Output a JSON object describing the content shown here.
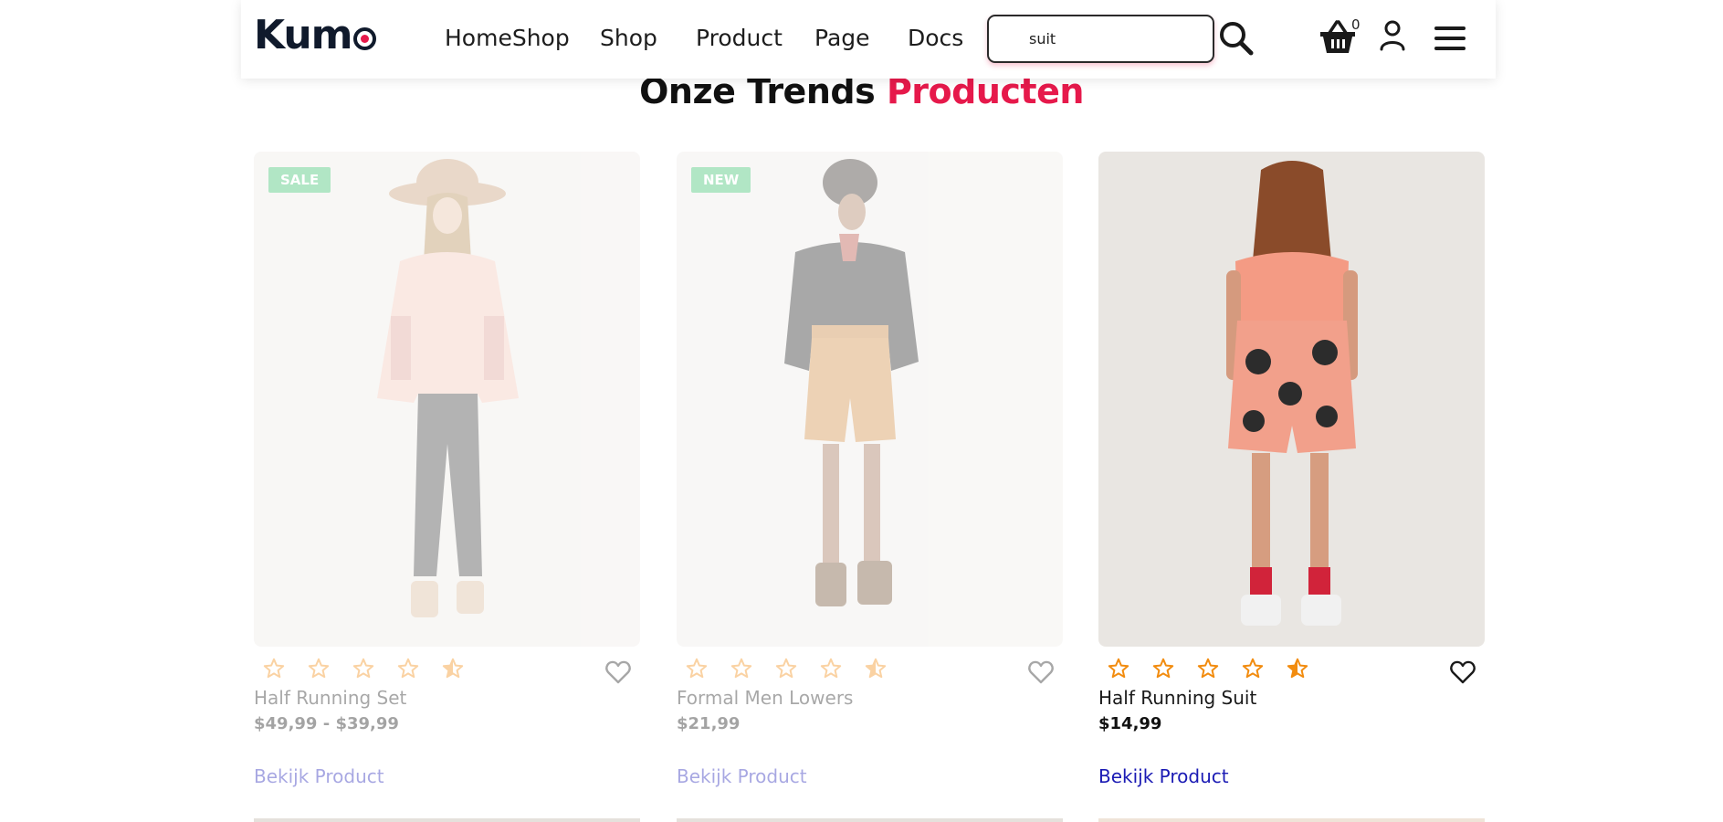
{
  "header": {
    "logo_text": "Kum",
    "nav": [
      "HomeShop",
      "Shop",
      "Product",
      "Page",
      "Docs"
    ],
    "search": {
      "value": "suit",
      "placeholder": ""
    },
    "cart_count": "0",
    "icons": [
      "search-icon",
      "basket-icon",
      "user-icon",
      "hamburger-menu-icon"
    ]
  },
  "section": {
    "title_main": "Onze Trends",
    "title_accent": "Producten"
  },
  "colors": {
    "accent": "#e6194b",
    "badge": "#34bf6a",
    "star": "#f28c0f",
    "link": "#1a1ab4"
  },
  "products": [
    {
      "badge": "SALE",
      "rating": 4.5,
      "name": "Half Running Set",
      "price": "$49,99 - $39,99",
      "link": "Bekijk Product",
      "faded": true
    },
    {
      "badge": "NEW",
      "rating": 4.5,
      "name": "Formal Men Lowers",
      "price": "$21,99",
      "link": "Bekijk Product",
      "faded": true
    },
    {
      "badge": "",
      "rating": 4.5,
      "name": "Half Running Suit",
      "price": "$14,99",
      "link": "Bekijk Product",
      "faded": false
    }
  ]
}
